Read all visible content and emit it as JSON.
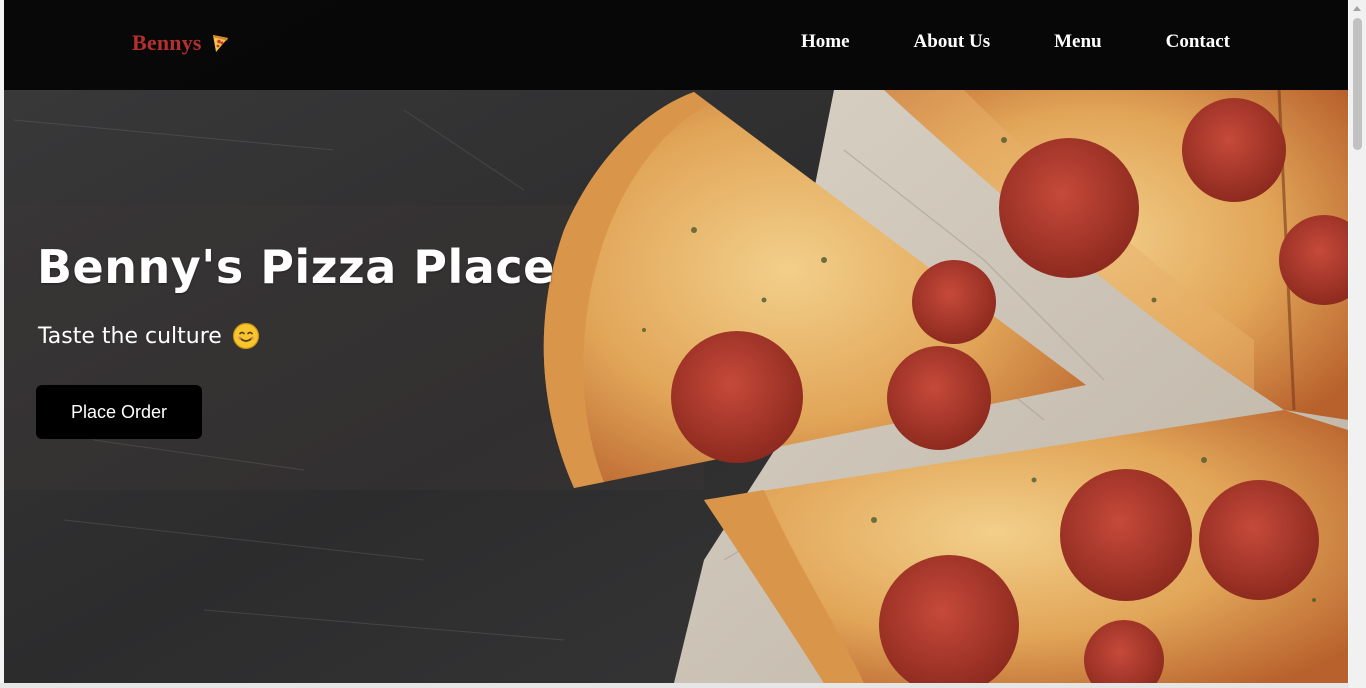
{
  "navbar": {
    "brand_name": "Bennys",
    "brand_icon": "pizza-slice-icon",
    "links": [
      {
        "label": "Home"
      },
      {
        "label": "About Us"
      },
      {
        "label": "Menu"
      },
      {
        "label": "Contact"
      }
    ]
  },
  "hero": {
    "title": "Benny's Pizza Place",
    "subtitle": "Taste the culture",
    "subtitle_icon": "smiling-face-icon",
    "cta_label": "Place Order",
    "background": "pepperoni-pizza-on-parchment-photo"
  },
  "colors": {
    "brand": "#b3302f",
    "navbar_bg": "#050505",
    "button_bg": "#000000",
    "text": "#ffffff"
  }
}
